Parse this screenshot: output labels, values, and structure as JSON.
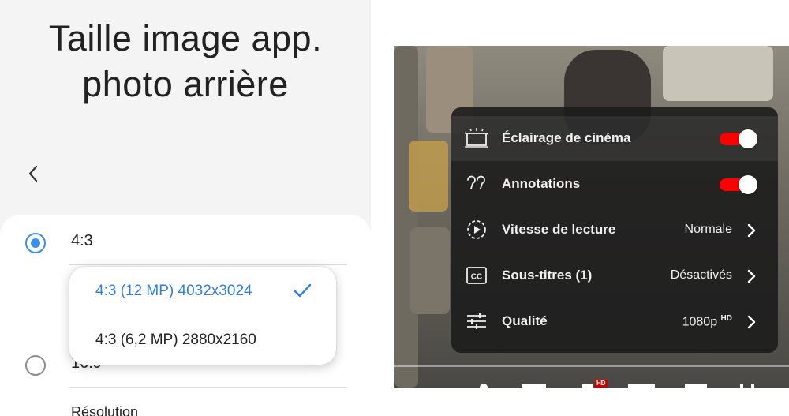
{
  "left": {
    "title_line1": "Taille image app.",
    "title_line2": "photo arrière",
    "options": [
      {
        "label": "4:3",
        "selected": true
      },
      {
        "label": "16:9",
        "selected": false
      }
    ],
    "resolution_label": "Résolution",
    "popup": {
      "items": [
        {
          "label": "4:3 (12 MP) 4032x3024",
          "selected": true
        },
        {
          "label": "4:3 (6,2 MP) 2880x2160",
          "selected": false
        }
      ]
    },
    "accent_color": "#3c8fe6"
  },
  "right": {
    "menu": [
      {
        "icon": "cinema-lighting-icon",
        "label": "Éclairage de cinéma",
        "toggle": true
      },
      {
        "icon": "annotations-icon",
        "label": "Annotations",
        "toggle": true
      },
      {
        "icon": "playback-speed-icon",
        "label": "Vitesse de lecture",
        "value": "Normale"
      },
      {
        "icon": "subtitles-icon",
        "label": "Sous-titres (1)",
        "value": "Désactivés"
      },
      {
        "icon": "quality-icon",
        "label": "Qualité",
        "value": "1080p",
        "value_sup": "HD"
      }
    ],
    "hd_badge": "HD",
    "toggle_color": "#ff0000"
  }
}
